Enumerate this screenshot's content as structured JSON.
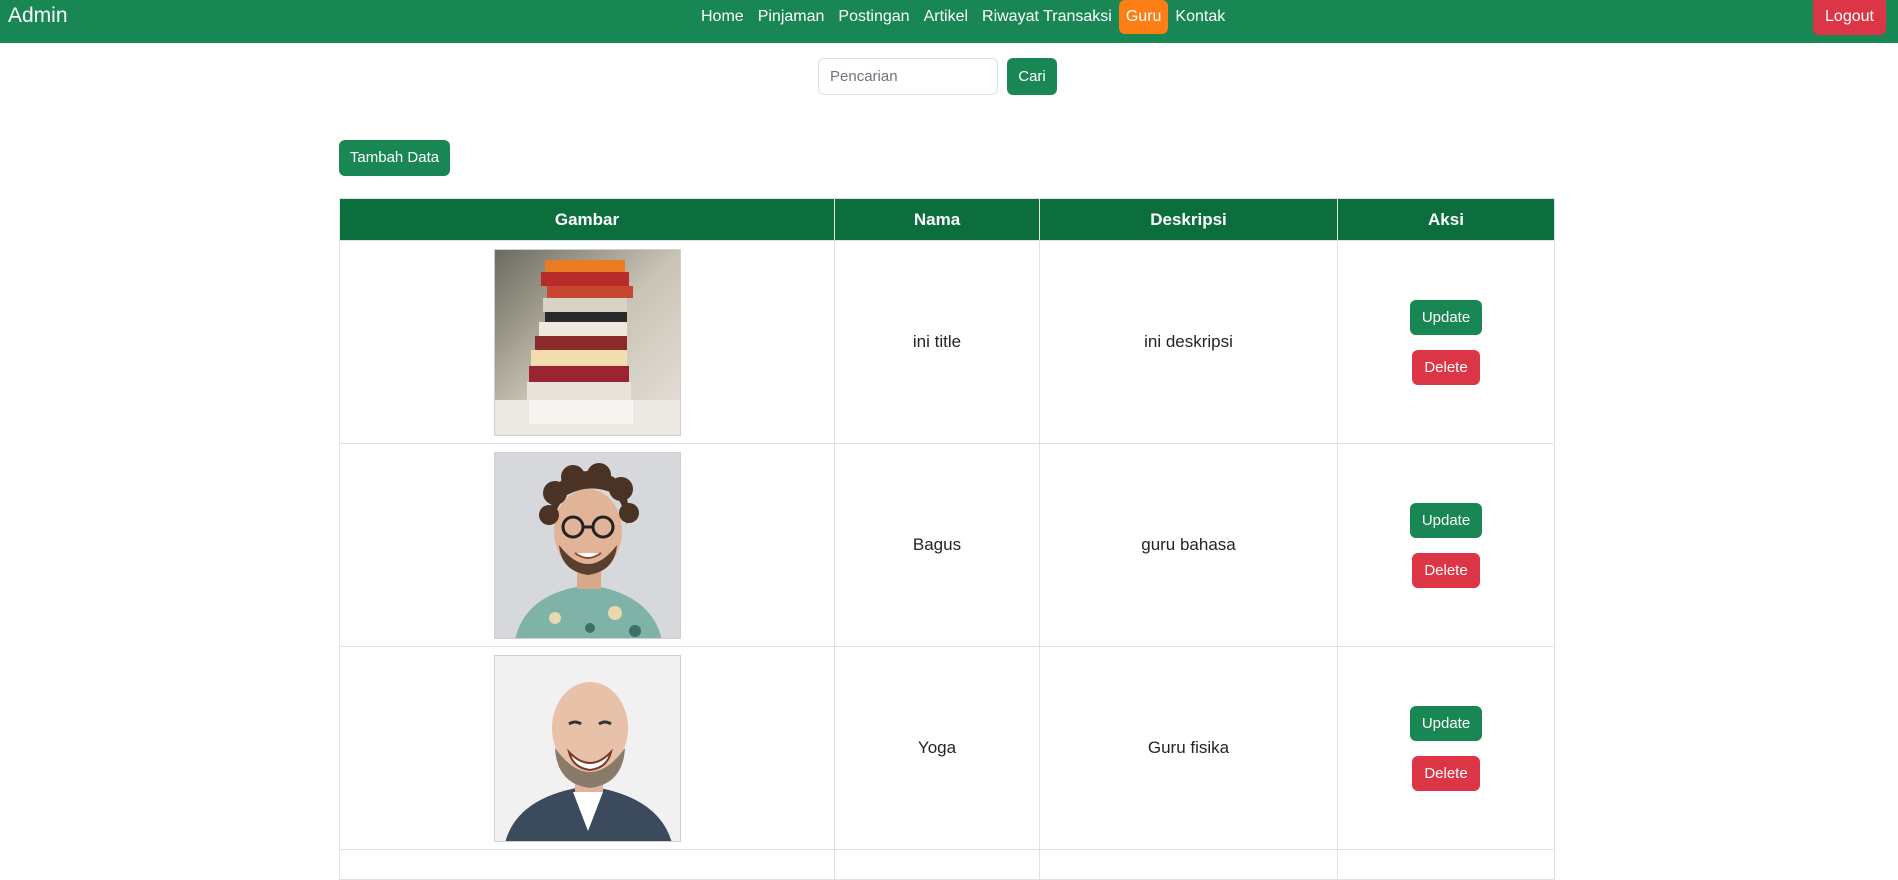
{
  "navbar": {
    "brand": "Admin",
    "links": [
      "Home",
      "Pinjaman",
      "Postingan",
      "Artikel",
      "Riwayat Transaksi",
      "Guru",
      "Kontak"
    ],
    "active": "Guru",
    "logout_label": "Logout"
  },
  "search": {
    "placeholder": "Pencarian",
    "value": "",
    "button_label": "Cari"
  },
  "add_button_label": "Tambah Data",
  "table": {
    "headers": [
      "Gambar",
      "Nama",
      "Deskripsi",
      "Aksi"
    ],
    "rows": [
      {
        "image": "books-stack-photo",
        "nama": "ini title",
        "deskripsi": "ini deskripsi",
        "update_label": "Update",
        "delete_label": "Delete"
      },
      {
        "image": "curly-hair-man-photo",
        "nama": "Bagus",
        "deskripsi": "guru bahasa",
        "update_label": "Update",
        "delete_label": "Delete"
      },
      {
        "image": "bald-bearded-man-photo",
        "nama": "Yoga",
        "deskripsi": "Guru fisika",
        "update_label": "Update",
        "delete_label": "Delete"
      }
    ]
  },
  "colors": {
    "primary": "#198754",
    "header": "#0d6e3d",
    "danger": "#dc3545",
    "active_nav": "#fd7e14"
  }
}
